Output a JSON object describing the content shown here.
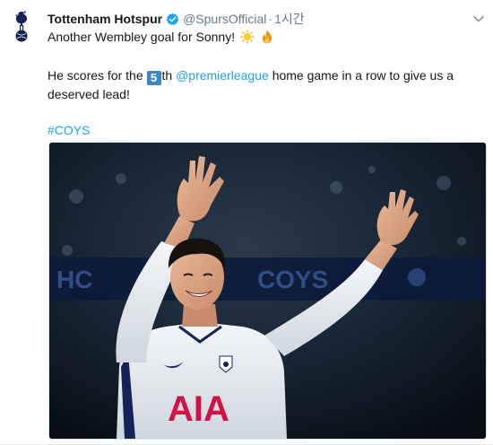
{
  "tweet": {
    "display_name": "Tottenham Hotspur",
    "handle": "@SpursOfficial",
    "time": "1시간",
    "line1": "Another Wembley goal for Sonny!",
    "line2_before": "He scores for the",
    "line2_number": "5",
    "line2_th": "th",
    "line2_mention": "@premierleague",
    "line2_after": "home game in a row to give us a",
    "line3": "deserved lead!",
    "hashtag": "#COYS"
  },
  "media": {
    "stand_text_left": "HC",
    "stand_text_right": "COYS",
    "shirt_sponsor": "AIA"
  },
  "colors": {
    "link": "#1da1f2",
    "verified": "#1da1f2",
    "secondary_text": "#657786",
    "keycap": "#3b88c3"
  },
  "icons": {
    "avatar": "spurs-cockerel-icon",
    "verified": "verified-badge-icon",
    "caret": "chevron-down-icon",
    "emoji1": "sun-emoji-icon",
    "emoji2": "fire-emoji-icon"
  }
}
